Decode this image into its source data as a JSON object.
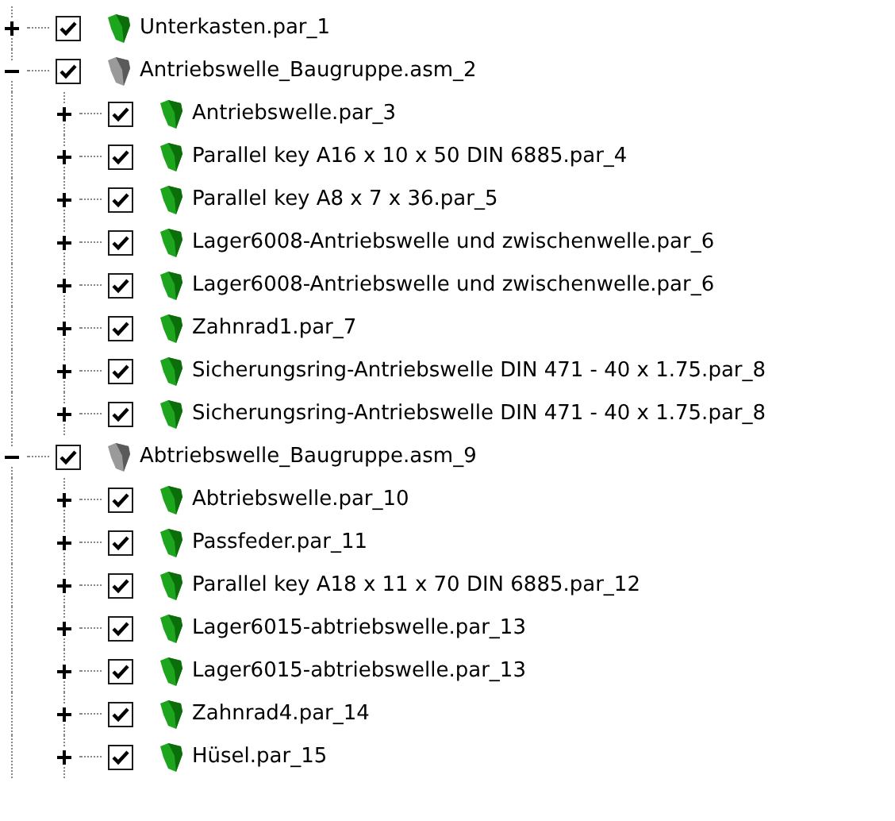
{
  "tree": [
    {
      "label": "Unterkasten.par_1",
      "kind": "part",
      "checked": true,
      "expanded": false
    },
    {
      "label": "Antriebswelle_Baugruppe.asm_2",
      "kind": "assembly",
      "checked": true,
      "expanded": true,
      "children": [
        {
          "label": "Antriebswelle.par_3",
          "kind": "part",
          "checked": true,
          "expanded": false
        },
        {
          "label": "Parallel key A16 x 10 x 50 DIN 6885.par_4",
          "kind": "part",
          "checked": true,
          "expanded": false
        },
        {
          "label": "Parallel key A8 x 7 x 36.par_5",
          "kind": "part",
          "checked": true,
          "expanded": false
        },
        {
          "label": "Lager6008-Antriebswelle und zwischenwelle.par_6",
          "kind": "part",
          "checked": true,
          "expanded": false
        },
        {
          "label": "Lager6008-Antriebswelle und zwischenwelle.par_6",
          "kind": "part",
          "checked": true,
          "expanded": false
        },
        {
          "label": "Zahnrad1.par_7",
          "kind": "part",
          "checked": true,
          "expanded": false
        },
        {
          "label": "Sicherungsring-Antriebswelle DIN 471 - 40 x 1.75.par_8",
          "kind": "part",
          "checked": true,
          "expanded": false
        },
        {
          "label": "Sicherungsring-Antriebswelle DIN 471 - 40 x 1.75.par_8",
          "kind": "part",
          "checked": true,
          "expanded": false
        }
      ]
    },
    {
      "label": "Abtriebswelle_Baugruppe.asm_9",
      "kind": "assembly",
      "checked": true,
      "expanded": true,
      "children": [
        {
          "label": "Abtriebswelle.par_10",
          "kind": "part",
          "checked": true,
          "expanded": false
        },
        {
          "label": "Passfeder.par_11",
          "kind": "part",
          "checked": true,
          "expanded": false
        },
        {
          "label": "Parallel key A18 x 11 x 70 DIN 6885.par_12",
          "kind": "part",
          "checked": true,
          "expanded": false
        },
        {
          "label": "Lager6015-abtriebswelle.par_13",
          "kind": "part",
          "checked": true,
          "expanded": false
        },
        {
          "label": "Lager6015-abtriebswelle.par_13",
          "kind": "part",
          "checked": true,
          "expanded": false
        },
        {
          "label": "Zahnrad4.par_14",
          "kind": "part",
          "checked": true,
          "expanded": false
        },
        {
          "label": "Hüsel.par_15",
          "kind": "part",
          "checked": true,
          "expanded": false
        }
      ]
    }
  ]
}
